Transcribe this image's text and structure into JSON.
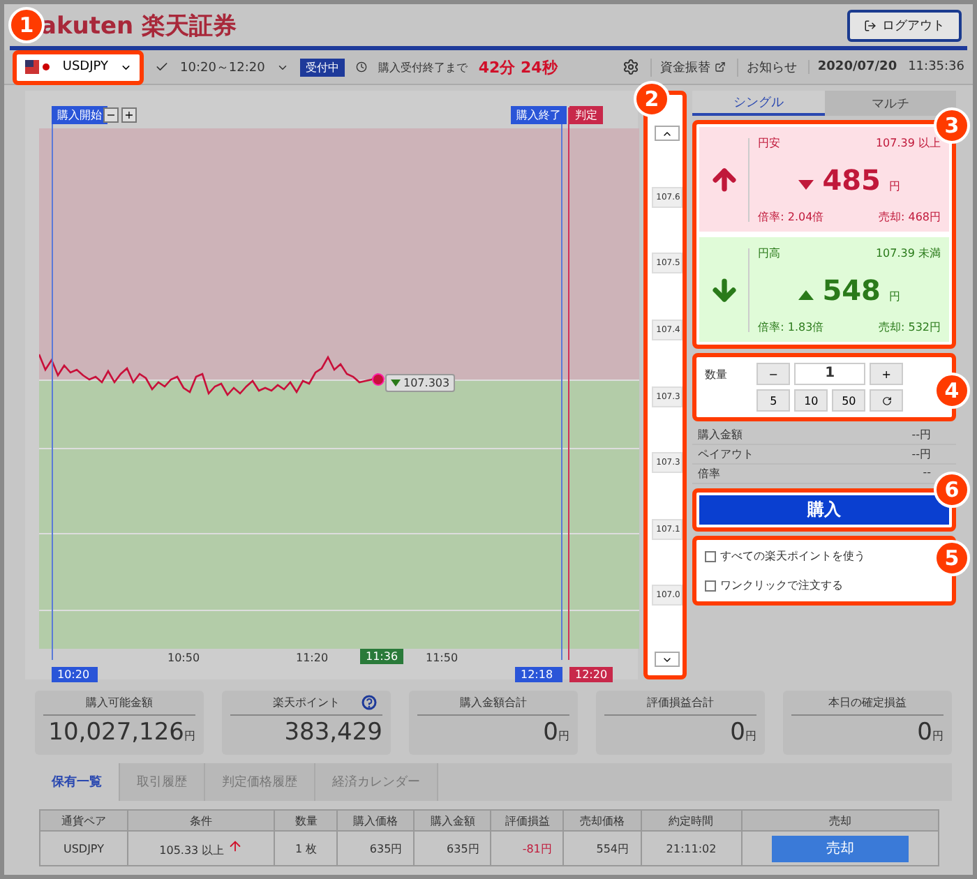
{
  "header": {
    "logo": "akuten 楽天証券",
    "logout": "ログアウト"
  },
  "toolbar": {
    "pair": "USDJPY",
    "session": "10:20～12:20",
    "status": "受付中",
    "deadline_label": "購入受付終了まで",
    "countdown": "42分 24秒",
    "transfer": "資金振替",
    "notice": "お知らせ",
    "date": "2020/07/20",
    "time": "11:35:36"
  },
  "chart": {
    "start_label": "購入開始",
    "zoom_out": "−",
    "zoom_in": "+",
    "end_label": "購入終了",
    "judge_label": "判定",
    "price_tag": "107.303",
    "x_labels": [
      "10:50",
      "11:20",
      "11:50"
    ],
    "current_time": "11:36",
    "start_time": "10:20",
    "end_time": "12:18",
    "judge_time": "12:20"
  },
  "scale": {
    "prices": [
      "107.6",
      "107.5",
      "107.4",
      "107.3",
      "107.3",
      "107.1",
      "107.0"
    ]
  },
  "tabs": [
    {
      "label": "シングル",
      "selected": true
    },
    {
      "label": "マルチ",
      "selected": false
    }
  ],
  "options": [
    {
      "kind": "up",
      "label": "円安",
      "condition": "107.39 以上",
      "price": "485",
      "unit": "円",
      "rate": "倍率: 2.04倍",
      "sell": "売却: 468円"
    },
    {
      "kind": "down",
      "label": "円高",
      "condition": "107.39 未満",
      "price": "548",
      "unit": "円",
      "rate": "倍率: 1.83倍",
      "sell": "売却: 532円"
    }
  ],
  "quantity": {
    "label": "数量",
    "minus": "−",
    "value": "1",
    "plus": "+",
    "presets": [
      "5",
      "10",
      "50"
    ]
  },
  "details": [
    {
      "label": "購入金額",
      "value": "--円"
    },
    {
      "label": "ペイアウト",
      "value": "--円"
    },
    {
      "label": "倍率",
      "value": "--"
    }
  ],
  "buy": "購入",
  "checks": [
    {
      "label": "すべての楽天ポイントを使う",
      "checked": false
    },
    {
      "label": "ワンクリックで注文する",
      "checked": false
    }
  ],
  "summary": [
    {
      "label": "購入可能金額",
      "value": "10,027,126",
      "unit": "円",
      "help": false
    },
    {
      "label": "楽天ポイント",
      "value": "383,429",
      "help": true
    },
    {
      "label": "購入金額合計",
      "value": "0",
      "unit": "円",
      "help": false
    },
    {
      "label": "評価損益合計",
      "value": "0",
      "unit": "円",
      "help": false
    },
    {
      "label": "本日の確定損益",
      "value": "0",
      "unit": "円",
      "help": false
    }
  ],
  "history_tabs": [
    {
      "label": "保有一覧",
      "selected": true
    },
    {
      "label": "取引履歴",
      "selected": false
    },
    {
      "label": "判定価格履歴",
      "selected": false
    },
    {
      "label": "経済カレンダー",
      "selected": false
    }
  ],
  "table": {
    "columns": [
      "通貨ペア",
      "条件",
      "数量",
      "購入価格",
      "購入金額",
      "評価損益",
      "売却価格",
      "約定時間",
      "売却"
    ],
    "rows": [
      {
        "pair": "USDJPY",
        "condition": "105.33 以上",
        "rising": true,
        "quantity": "1 枚",
        "price": "635円",
        "amount": "635円",
        "pl": "-81円",
        "loss": true,
        "sell_price": "554円",
        "time": "21:11:02",
        "action": "売却"
      }
    ]
  },
  "callouts": [
    "1",
    "2",
    "3",
    "4",
    "6",
    "5"
  ]
}
